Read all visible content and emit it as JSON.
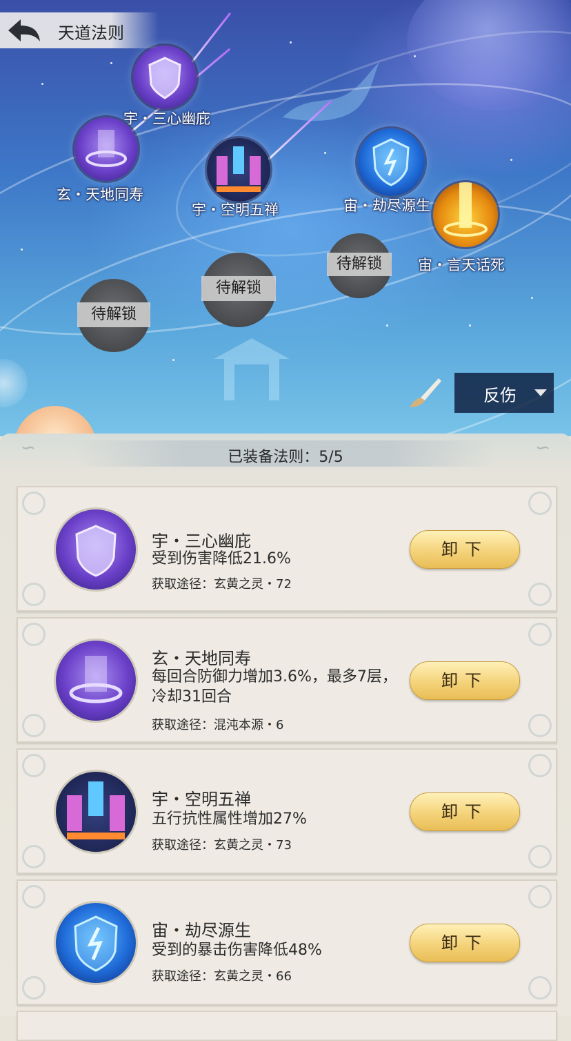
{
  "header": {
    "title": "天道法则",
    "back_icon": "back-arrow-icon"
  },
  "map": {
    "nodes": [
      {
        "label": "宇・三心幽庇",
        "icon": "shield-icon",
        "state": "unlocked"
      },
      {
        "label": "玄・天地同寿",
        "icon": "light-ring-icon",
        "state": "unlocked"
      },
      {
        "label": "宇・空明五禅",
        "icon": "prism-icon",
        "state": "unlocked"
      },
      {
        "label": "宙・劫尽源生",
        "icon": "rune-shield-icon",
        "state": "unlocked"
      },
      {
        "label": "宙・言天话死",
        "icon": "gold-beam-icon",
        "state": "unlocked"
      },
      {
        "label": "待解锁",
        "state": "locked"
      },
      {
        "label": "待解锁",
        "state": "locked"
      },
      {
        "label": "待解锁",
        "state": "locked"
      }
    ],
    "filter": {
      "selected": "反伤"
    },
    "brush_icon": "brush-icon"
  },
  "panel": {
    "equipped_label": "已装备法则：5/5",
    "cards": [
      {
        "name": "宇・三心幽庇",
        "desc": "受到伤害降低21.6%",
        "source": "获取途径：玄黄之灵・72",
        "button": "卸下",
        "icon": "shield-icon"
      },
      {
        "name": "玄・天地同寿",
        "desc": "每回合防御力增加3.6%，最多7层，冷却31回合",
        "source": "获取途径：混沌本源・6",
        "button": "卸下",
        "icon": "light-ring-icon"
      },
      {
        "name": "宇・空明五禅",
        "desc": "五行抗性属性增加27%",
        "source": "获取途径：玄黄之灵・73",
        "button": "卸下",
        "icon": "prism-icon"
      },
      {
        "name": "宙・劫尽源生",
        "desc": "受到的暴击伤害降低48%",
        "source": "获取途径：玄黄之灵・66",
        "button": "卸下",
        "icon": "rune-shield-icon"
      }
    ]
  },
  "colors": {
    "button_gold": "#f4d37a",
    "card_bg": "#efebe4",
    "map_blue": "#3e78c8"
  }
}
